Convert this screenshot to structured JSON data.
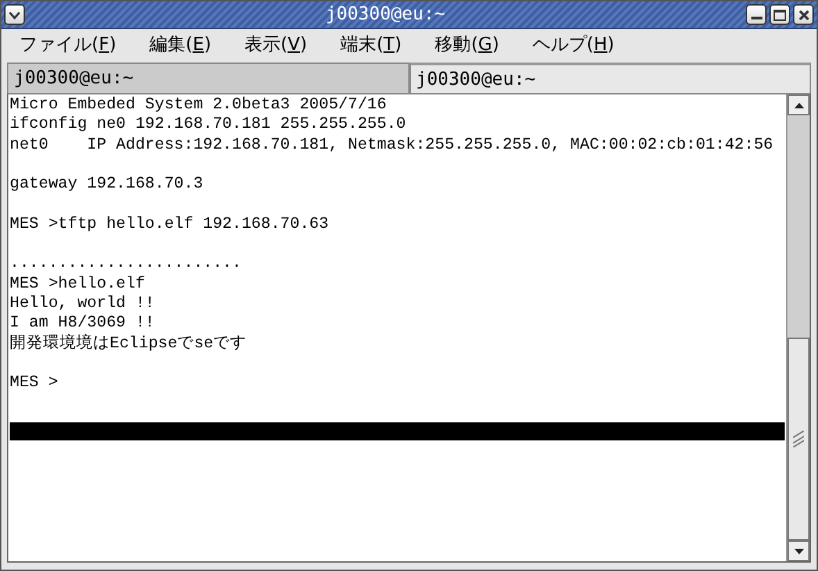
{
  "window": {
    "title": "j00300@eu:~"
  },
  "menu": [
    {
      "before": "ファイル(",
      "key": "F",
      "after": ")"
    },
    {
      "before": "編集(",
      "key": "E",
      "after": ")"
    },
    {
      "before": "表示(",
      "key": "V",
      "after": ")"
    },
    {
      "before": "端末(",
      "key": "T",
      "after": ")"
    },
    {
      "before": "移動(",
      "key": "G",
      "after": ")"
    },
    {
      "before": "ヘルプ(",
      "key": "H",
      "after": ")"
    }
  ],
  "tabs": [
    {
      "label": "j00300@eu:~",
      "selected": false
    },
    {
      "label": "j00300@eu:~",
      "selected": true
    }
  ],
  "terminal": {
    "blocks": [
      [
        "Micro Embeded System 2.0beta3 2005/7/16",
        "ifconfig ne0 192.168.70.181 255.255.255.0",
        "net0    IP Address:192.168.70.181, Netmask:255.255.255.0, MAC:00:02:cb:01:42:56"
      ],
      [
        "gateway 192.168.70.3"
      ],
      [
        "MES >tftp hello.elf 192.168.70.63"
      ],
      [
        "........................",
        "MES >hello.elf",
        "Hello, world !!",
        "I am H8/3069 !!",
        "開発環境境はEclipseでseです"
      ],
      [
        "MES >"
      ]
    ]
  }
}
